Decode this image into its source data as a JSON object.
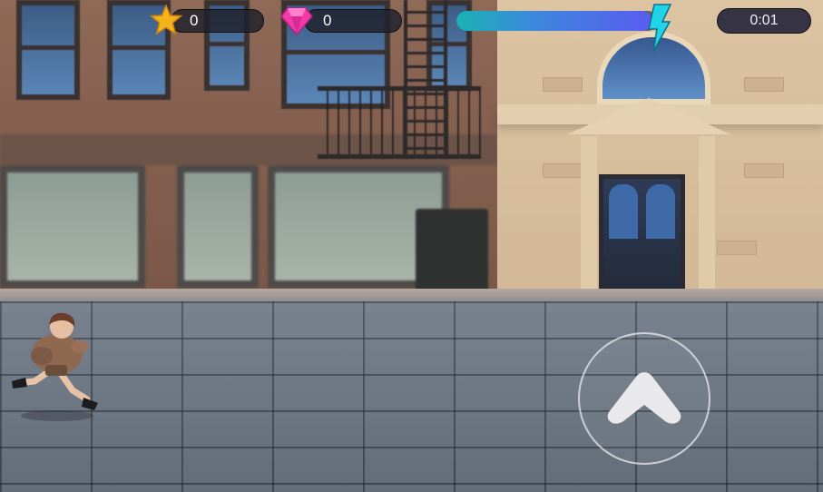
{
  "hud": {
    "stars": {
      "icon": "star-icon",
      "value": "0"
    },
    "gems": {
      "icon": "gem-icon",
      "value": "0"
    },
    "energy": {
      "icon": "lightning-bolt-icon",
      "level": 0.97
    },
    "timer": "0:01"
  },
  "controls": {
    "jump_button": {
      "icon": "chevron-up-icon"
    }
  },
  "colors": {
    "star": "#f6b21b",
    "gem": "#f03ca8",
    "energy_start": "#19b3b3",
    "energy_end": "#5a5cf0",
    "bolt": "#21d3e8",
    "hud_pill": "#1e202c"
  }
}
